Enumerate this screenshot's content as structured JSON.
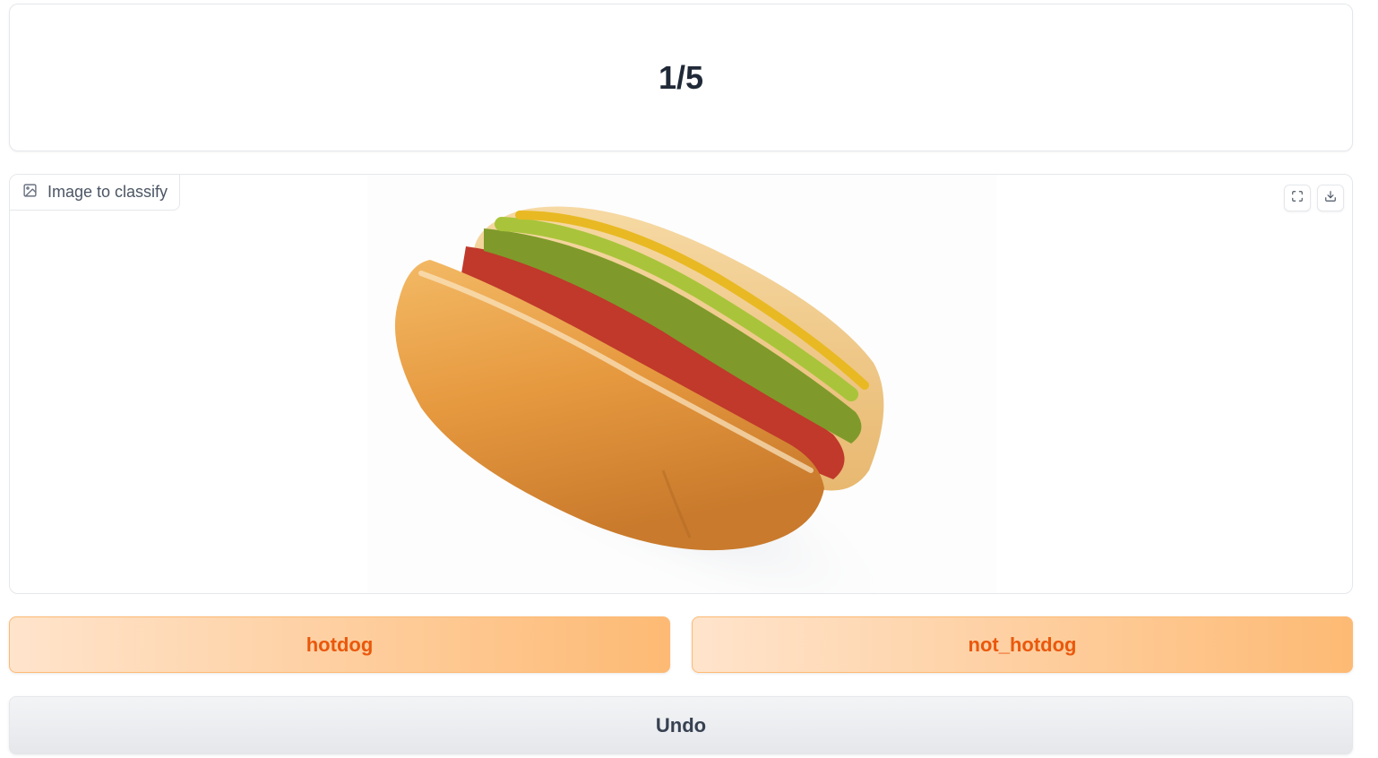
{
  "progress": {
    "text": "1/5"
  },
  "image_panel": {
    "label": "Image to classify",
    "label_icon": "image-icon",
    "tools": [
      "fullscreen-icon",
      "download-icon"
    ]
  },
  "buttons": {
    "hotdog": "hotdog",
    "not_hotdog": "not_hotdog",
    "undo": "Undo"
  },
  "colors": {
    "accent_text": "#ea580c",
    "accent_light": "#ffe4cc",
    "accent_dark": "#fdba74",
    "secondary_bg": "#e5e7eb"
  }
}
